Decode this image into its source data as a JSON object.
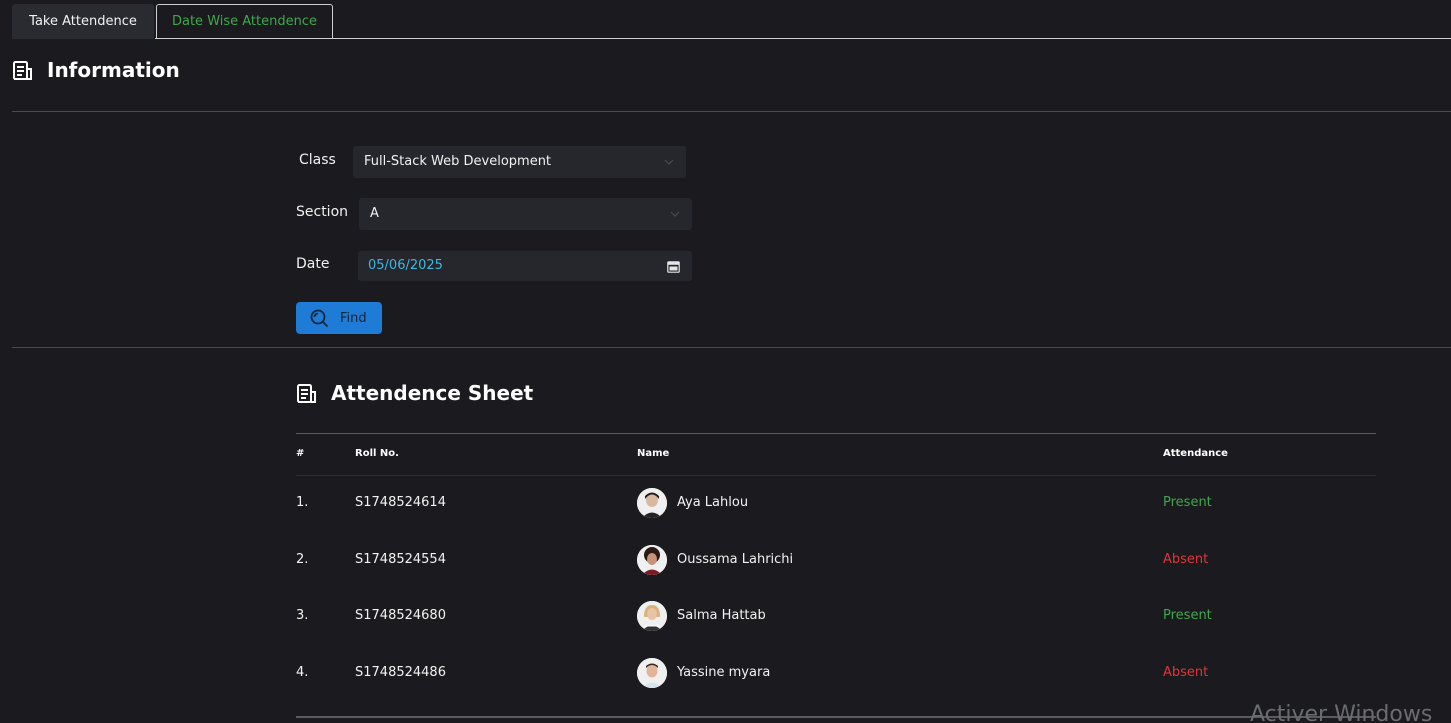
{
  "tabs": {
    "take_attendance": "Take Attendence",
    "date_wise_attendance": "Date Wise Attendence"
  },
  "information": {
    "title": "Information"
  },
  "form": {
    "class_label": "Class",
    "class_value": "Full-Stack Web Development",
    "section_label": "Section",
    "section_value": "A",
    "date_label": "Date",
    "date_value": "05/06/2025",
    "find_label": "Find"
  },
  "sheet": {
    "title": "Attendence Sheet",
    "columns": [
      "#",
      "Roll No.",
      "Name",
      "Attendance"
    ],
    "rows": [
      {
        "num": "1.",
        "roll": "S1748524614",
        "name": "Aya Lahlou",
        "attendance": "Present"
      },
      {
        "num": "2.",
        "roll": "S1748524554",
        "name": "Oussama Lahrichi",
        "attendance": "Absent"
      },
      {
        "num": "3.",
        "roll": "S1748524680",
        "name": "Salma Hattab",
        "attendance": "Present"
      },
      {
        "num": "4.",
        "roll": "S1748524486",
        "name": "Yassine myara",
        "attendance": "Absent"
      }
    ]
  },
  "colors": {
    "present": "#3ea84b",
    "absent": "#e0353a",
    "accent": "#1e7bd6",
    "background": "#1b1b1f"
  },
  "watermark": "Activer Windows"
}
